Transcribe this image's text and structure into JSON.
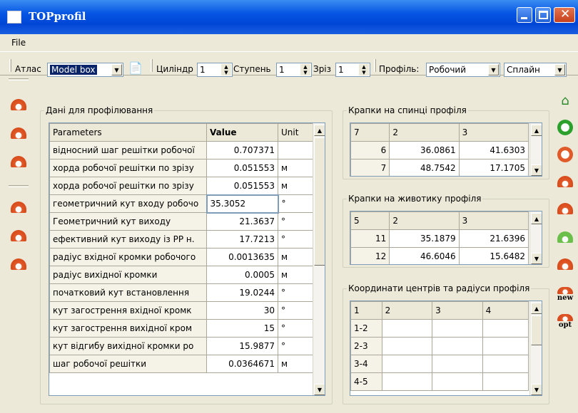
{
  "window": {
    "title": "TOPprofil"
  },
  "menu": {
    "file": "File"
  },
  "toolbar": {
    "atlas_label": "Атлас",
    "atlas_value": "Model box",
    "cylinder_label": "Циліндр",
    "cylinder_value": "1",
    "stage_label": "Ступень",
    "stage_value": "1",
    "section_label": "Зріз",
    "section_value": "1",
    "profile_label": "Профіль:",
    "profile_value": "Робочий",
    "spline_value": "Сплайн"
  },
  "left_panel": {
    "title": "Дані для профілювання",
    "headers": {
      "param": "Parameters",
      "value": "Value",
      "unit": "Unit"
    },
    "rows": [
      {
        "p": "відносний шаг решітки робочої",
        "v": "0.707371",
        "u": ""
      },
      {
        "p": "хорда робочої решітки по зрізу",
        "v": "0.051553",
        "u": "м"
      },
      {
        "p": "хорда робочої решітки по зрізу",
        "v": "0.051553",
        "u": "м"
      },
      {
        "p": "геометричний кут входу робочо",
        "v": "35.3052",
        "u": "°"
      },
      {
        "p": "Геометричний кут виходу",
        "v": "21.3637",
        "u": "°"
      },
      {
        "p": "ефективний кут виходу із РР н.",
        "v": "17.7213",
        "u": "°"
      },
      {
        "p": "радіус вхідної кромки робочого",
        "v": "0.0013635",
        "u": "м"
      },
      {
        "p": "радіус вихідної кромки",
        "v": "0.0005",
        "u": "м"
      },
      {
        "p": "початковий кут встановлення",
        "v": "19.0244",
        "u": "°"
      },
      {
        "p": "кут загострення вхідної кромк",
        "v": "30",
        "u": "°"
      },
      {
        "p": "кут загострення вихідної кром",
        "v": "15",
        "u": "°"
      },
      {
        "p": "кут відгибу вихідної кромки ро",
        "v": "15.9877",
        "u": "°"
      },
      {
        "p": "шаг робочої решітки",
        "v": "0.0364671",
        "u": "м"
      }
    ]
  },
  "back_points": {
    "title": "Крапки на спинці профіля",
    "header": [
      "7",
      "2",
      "3"
    ],
    "rows": [
      [
        "6",
        "36.0861",
        "41.6303"
      ],
      [
        "7",
        "48.7542",
        "17.1705"
      ]
    ]
  },
  "belly_points": {
    "title": "Крапки на животику профіля",
    "header": [
      "5",
      "2",
      "3"
    ],
    "rows": [
      [
        "11",
        "35.1879",
        "21.6396"
      ],
      [
        "12",
        "46.6046",
        "15.6482"
      ]
    ]
  },
  "centers": {
    "title": "Координати центрів та радіуси профіля",
    "header": [
      "1",
      "2",
      "3",
      "4"
    ],
    "rows": [
      [
        "1-2"
      ],
      [
        "2-3"
      ],
      [
        "3-4"
      ],
      [
        "4-5"
      ]
    ]
  },
  "right_tools": {
    "new": "new",
    "opt": "opt"
  },
  "colors": {
    "title_blue": "#0554e3",
    "icon_orange": "#d84a1b",
    "selection": "#0a246a"
  }
}
